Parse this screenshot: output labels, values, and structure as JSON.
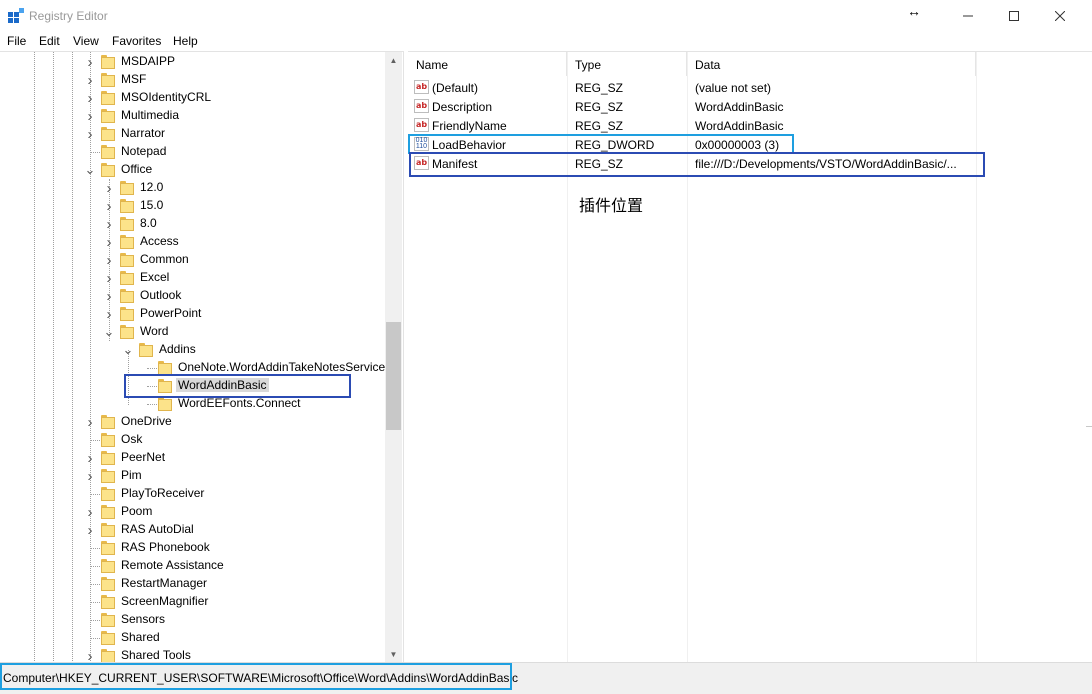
{
  "window": {
    "title": "Registry Editor",
    "minimize_icon": "minimize-icon",
    "maximize_icon": "maximize-icon",
    "close_icon": "close-icon"
  },
  "menu": [
    "File",
    "Edit",
    "View",
    "Favorites",
    "Help"
  ],
  "tree": [
    {
      "label": "MSDAIPP",
      "toggle": "collapsed"
    },
    {
      "label": "MSF",
      "toggle": "collapsed"
    },
    {
      "label": "MSOIdentityCRL",
      "toggle": "collapsed"
    },
    {
      "label": "Multimedia",
      "toggle": "collapsed"
    },
    {
      "label": "Narrator",
      "toggle": "collapsed"
    },
    {
      "label": "Notepad",
      "toggle": "none"
    },
    {
      "label": "Office",
      "toggle": "expanded"
    },
    {
      "label": "12.0",
      "toggle": "collapsed"
    },
    {
      "label": "15.0",
      "toggle": "collapsed"
    },
    {
      "label": "8.0",
      "toggle": "collapsed"
    },
    {
      "label": "Access",
      "toggle": "collapsed"
    },
    {
      "label": "Common",
      "toggle": "collapsed"
    },
    {
      "label": "Excel",
      "toggle": "collapsed"
    },
    {
      "label": "Outlook",
      "toggle": "collapsed"
    },
    {
      "label": "PowerPoint",
      "toggle": "collapsed"
    },
    {
      "label": "Word",
      "toggle": "expanded"
    },
    {
      "label": "Addins",
      "toggle": "expanded"
    },
    {
      "label": "OneNote.WordAddinTakeNotesService",
      "toggle": "none"
    },
    {
      "label": "WordAddinBasic",
      "toggle": "none",
      "selected": true
    },
    {
      "label": "WordEEFonts.Connect",
      "toggle": "none"
    },
    {
      "label": "OneDrive",
      "toggle": "collapsed"
    },
    {
      "label": "Osk",
      "toggle": "none"
    },
    {
      "label": "PeerNet",
      "toggle": "collapsed"
    },
    {
      "label": "Pim",
      "toggle": "collapsed"
    },
    {
      "label": "PlayToReceiver",
      "toggle": "none"
    },
    {
      "label": "Poom",
      "toggle": "collapsed"
    },
    {
      "label": "RAS AutoDial",
      "toggle": "collapsed"
    },
    {
      "label": "RAS Phonebook",
      "toggle": "none"
    },
    {
      "label": "Remote Assistance",
      "toggle": "none"
    },
    {
      "label": "RestartManager",
      "toggle": "none"
    },
    {
      "label": "ScreenMagnifier",
      "toggle": "none"
    },
    {
      "label": "Sensors",
      "toggle": "none"
    },
    {
      "label": "Shared",
      "toggle": "none"
    },
    {
      "label": "Shared Tools",
      "toggle": "collapsed"
    }
  ],
  "list": {
    "columns": [
      "Name",
      "Type",
      "Data"
    ],
    "rows": [
      {
        "name": "(Default)",
        "type": "REG_SZ",
        "data": "(value not set)",
        "icon": "string-value-icon"
      },
      {
        "name": "Description",
        "type": "REG_SZ",
        "data": "WordAddinBasic",
        "icon": "string-value-icon"
      },
      {
        "name": "FriendlyName",
        "type": "REG_SZ",
        "data": "WordAddinBasic",
        "icon": "string-value-icon"
      },
      {
        "name": "LoadBehavior",
        "type": "REG_DWORD",
        "data": "0x00000003 (3)",
        "icon": "dword-value-icon"
      },
      {
        "name": "Manifest",
        "type": "REG_SZ",
        "data": "file:///D:/Developments/VSTO/WordAddinBasic/...",
        "icon": "string-value-icon"
      }
    ],
    "annotation": "插件位置"
  },
  "statusbar": {
    "path": "Computer\\HKEY_CURRENT_USER\\SOFTWARE\\Microsoft\\Office\\Word\\Addins\\WordAddinBasic"
  },
  "colors": {
    "highlight_light_blue": "#1e9fe0",
    "highlight_dark_blue": "#2b4bb3",
    "folder_yellow": "#fce38a",
    "selection_gray": "#d9d9d9"
  }
}
